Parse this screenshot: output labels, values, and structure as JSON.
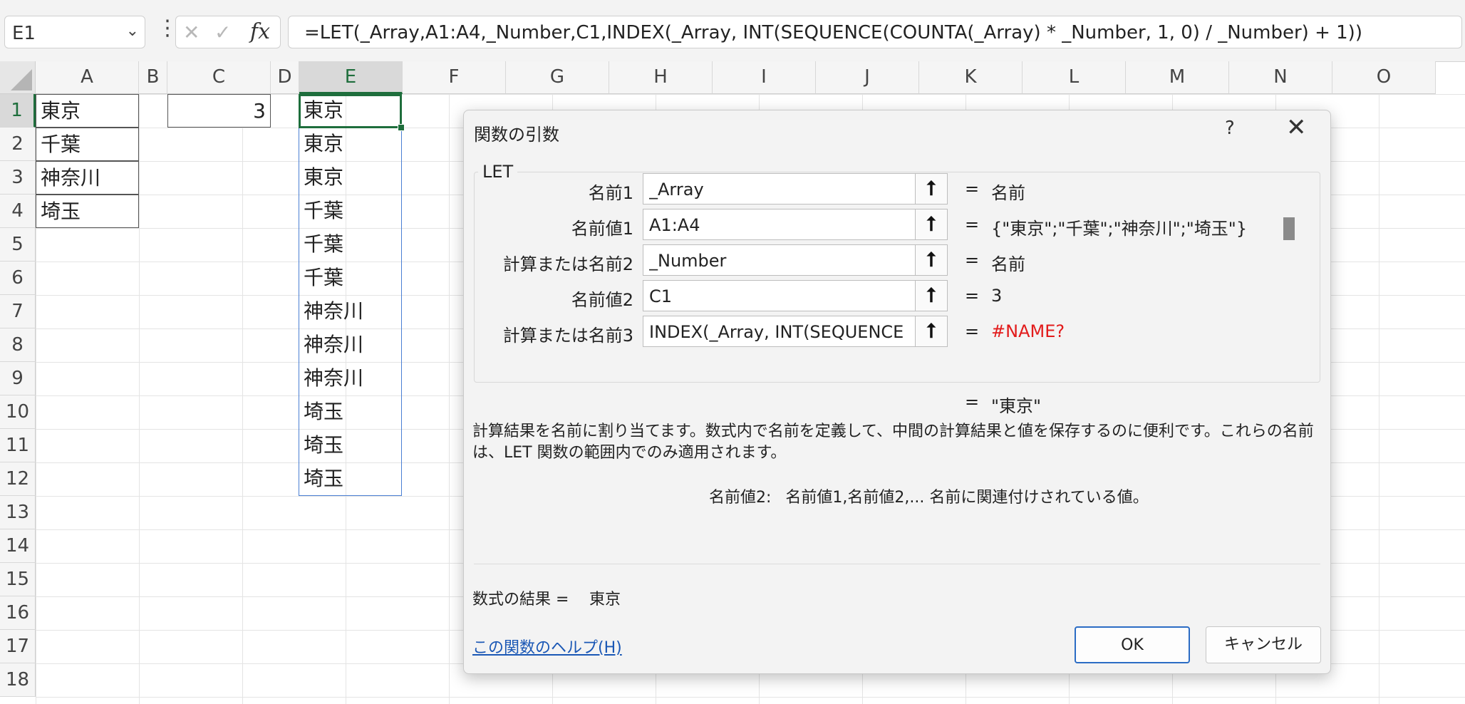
{
  "formula_bar": {
    "name_box": "E1",
    "formula": "=LET(_Array,A1:A4,_Number,C1,INDEX(_Array, INT(SEQUENCE(COUNTA(_Array) * _Number, 1, 0) / _Number) + 1))",
    "dots": "⋮",
    "cancel_glyph": "✕",
    "enter_glyph": "✓",
    "fx": "fx"
  },
  "columns": [
    "A",
    "B",
    "C",
    "D",
    "E",
    "F",
    "G",
    "H",
    "I",
    "J",
    "K",
    "L",
    "M",
    "N",
    "O"
  ],
  "rows": [
    "1",
    "2",
    "3",
    "4",
    "5",
    "6",
    "7",
    "8",
    "9",
    "10",
    "11",
    "12",
    "13",
    "14",
    "15",
    "16",
    "17",
    "18"
  ],
  "cells": {
    "A": [
      "東京",
      "千葉",
      "神奈川",
      "埼玉"
    ],
    "C1": "3",
    "E": [
      "東京",
      "東京",
      "東京",
      "千葉",
      "千葉",
      "千葉",
      "神奈川",
      "神奈川",
      "神奈川",
      "埼玉",
      "埼玉",
      "埼玉"
    ]
  },
  "dialog": {
    "title": "関数の引数",
    "help_glyph": "?",
    "close_glyph": "✕",
    "function_name": "LET",
    "args": [
      {
        "label": "名前1",
        "value": "_Array",
        "result": "名前",
        "error": false
      },
      {
        "label": "名前値1",
        "value": "A1:A4",
        "result": "{\"東京\";\"千葉\";\"神奈川\";\"埼玉\"}",
        "error": false
      },
      {
        "label": "計算または名前2",
        "value": "_Number",
        "result": "名前",
        "error": false
      },
      {
        "label": "名前値2",
        "value": "C1",
        "result": "3",
        "error": false
      },
      {
        "label": "計算または名前3",
        "value": "INDEX(_Array, INT(SEQUENCE",
        "result": "#NAME?",
        "error": true
      }
    ],
    "eq": "=",
    "ref_glyph": "🡅",
    "total_result": "\"東京\"",
    "description": "計算結果を名前に割り当てます。数式内で名前を定義して、中間の計算結果と値を保存するのに便利です。これらの名前は、LET 関数の範囲内でのみ適用されます。",
    "arg_hint_name": "名前値2:",
    "arg_hint_text": "名前値1,名前値2,... 名前に関連付けされている値。",
    "formula_result_label": "数式の結果 =",
    "formula_result_value": "東京",
    "help_link": "この関数のヘルプ(H)",
    "ok": "OK",
    "cancel": "キャンセル"
  },
  "colors": {
    "selection_green": "#1e6e3c",
    "error_red": "#e21b1b",
    "link_blue": "#1a57b5",
    "ok_border": "#2b6cc4"
  }
}
